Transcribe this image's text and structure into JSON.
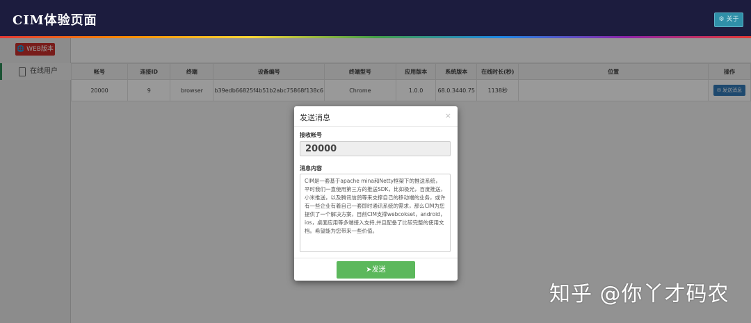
{
  "header": {
    "title": "CIM体验页面",
    "about_label": "关于"
  },
  "sidebar": {
    "web_button": "WEB版本",
    "online_users": "在线用户"
  },
  "table": {
    "columns": [
      "帐号",
      "连接ID",
      "终端",
      "设备编号",
      "终端型号",
      "应用版本",
      "系统版本",
      "在线时长(秒)",
      "位置",
      "操作"
    ],
    "rows": [
      {
        "account": "20000",
        "conn_id": "9",
        "terminal": "browser",
        "device_no": "b39edb66825f4b51b2abc75868f138c6",
        "model": "Chrome",
        "app_ver": "1.0.0",
        "sys_ver": "68.0.3440.75",
        "online": "1138秒",
        "location": "",
        "action": "发送消息"
      }
    ]
  },
  "modal": {
    "title": "发送消息",
    "close": "×",
    "account_label": "接收帐号",
    "account_value": "20000",
    "content_label": "消息内容",
    "content_value": "CIM是一套基于apache mina和Netty框架下的推送系统，平时我们一直使用第三方的推送SDK，比如极光，百度推送，小米推送，以及腾讯信鸽等来支撑自己的移动端的业务，或许有一些企业有着自己一套即时通讯系统的需求，那么CIM为您提供了一个解决方案，目前CIM支撑webcokset，android，ios，桌面应用等多端接入支持,并且配备了比较完整的使用文档。希望能为您带来一些价值。",
    "send_button": "发送"
  },
  "watermark": "知乎 @你丫才码农",
  "colors": {
    "topbar": "#1c1c3e",
    "web_button": "#c9302c",
    "send_button": "#5cb85c",
    "small_send": "#337ab7"
  }
}
